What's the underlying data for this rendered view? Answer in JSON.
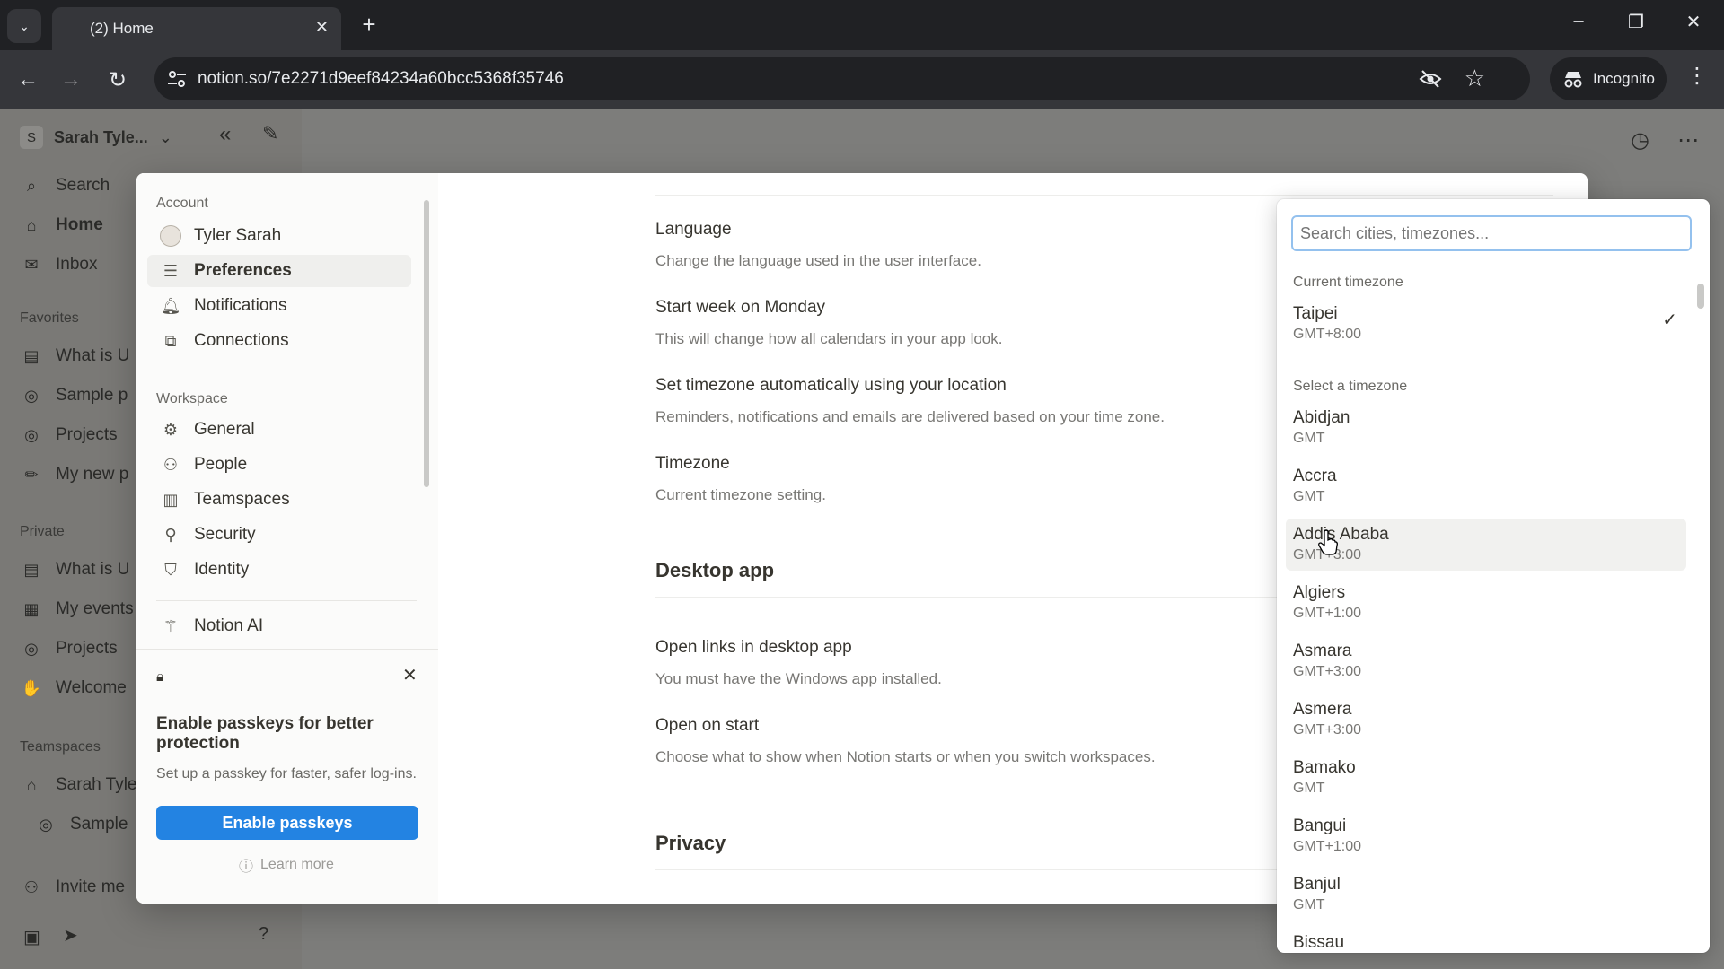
{
  "browser": {
    "tab_title": "(2) Home",
    "tab_close": "✕",
    "new_tab": "+",
    "url": "notion.so/7e2271d9eef84234a60bcc5368f35746",
    "incognito_label": "Incognito"
  },
  "sidebar_bg": {
    "workspace_initial": "S",
    "workspace_name": "Sarah Tyle...",
    "items": [
      {
        "label": "Search"
      },
      {
        "label": "Home"
      },
      {
        "label": "Inbox"
      }
    ],
    "favorites_label": "Favorites",
    "favorites": [
      "What is U",
      "Sample p",
      "Projects",
      "My new p"
    ],
    "private_label": "Private",
    "private": [
      "What is U",
      "My events",
      "Projects",
      "Welcome"
    ],
    "teamspaces_label": "Teamspaces",
    "teamspaces": [
      "Sarah Tyle",
      "Sample"
    ],
    "invite_label": "Invite me"
  },
  "settings_nav": {
    "account_label": "Account",
    "account_items": [
      {
        "label": "Tyler Sarah"
      },
      {
        "label": "Preferences"
      },
      {
        "label": "Notifications"
      },
      {
        "label": "Connections"
      }
    ],
    "workspace_label": "Workspace",
    "workspace_items": [
      {
        "label": "General"
      },
      {
        "label": "People"
      },
      {
        "label": "Teamspaces"
      },
      {
        "label": "Security"
      },
      {
        "label": "Identity"
      },
      {
        "label": "Notion AI"
      }
    ]
  },
  "passkey": {
    "title": "Enable passkeys for better protection",
    "description": "Set up a passkey for faster, safer log-ins.",
    "button": "Enable passkeys",
    "learn_more": "Learn more"
  },
  "preferences": {
    "rows": [
      {
        "title": "Language",
        "desc": "Change the language used in the user interface."
      },
      {
        "title": "Start week on Monday",
        "desc": "This will change how all calendars in your app look."
      },
      {
        "title": "Set timezone automatically using your location",
        "desc": "Reminders, notifications and emails are delivered based on your time zone."
      },
      {
        "title": "Timezone",
        "desc": "Current timezone setting."
      }
    ],
    "desktop_heading": "Desktop app",
    "open_links_title": "Open links in desktop app",
    "open_links_desc_before": "You must have the ",
    "open_links_link": "Windows app",
    "open_links_desc_after": " installed.",
    "open_start_title": "Open on start",
    "open_start_desc": "Choose what to show when Notion starts or when you switch workspaces.",
    "privacy_heading": "Privacy"
  },
  "timezone_dropdown": {
    "search_placeholder": "Search cities, timezones...",
    "current_label": "Current timezone",
    "current": {
      "city": "Taipei",
      "offset": "GMT+8:00",
      "selected": true
    },
    "select_label": "Select a timezone",
    "options": [
      {
        "city": "Abidjan",
        "offset": "GMT"
      },
      {
        "city": "Accra",
        "offset": "GMT"
      },
      {
        "city": "Addis Ababa",
        "offset": "GMT+3:00",
        "hovered": true
      },
      {
        "city": "Algiers",
        "offset": "GMT+1:00"
      },
      {
        "city": "Asmara",
        "offset": "GMT+3:00"
      },
      {
        "city": "Asmera",
        "offset": "GMT+3:00"
      },
      {
        "city": "Bamako",
        "offset": "GMT"
      },
      {
        "city": "Bangui",
        "offset": "GMT+1:00"
      },
      {
        "city": "Banjul",
        "offset": "GMT"
      },
      {
        "city": "Bissau",
        "offset": ""
      }
    ]
  },
  "colors": {
    "accent": "#2383e2",
    "chrome_dark": "#202124",
    "chrome_mid": "#35363a"
  }
}
